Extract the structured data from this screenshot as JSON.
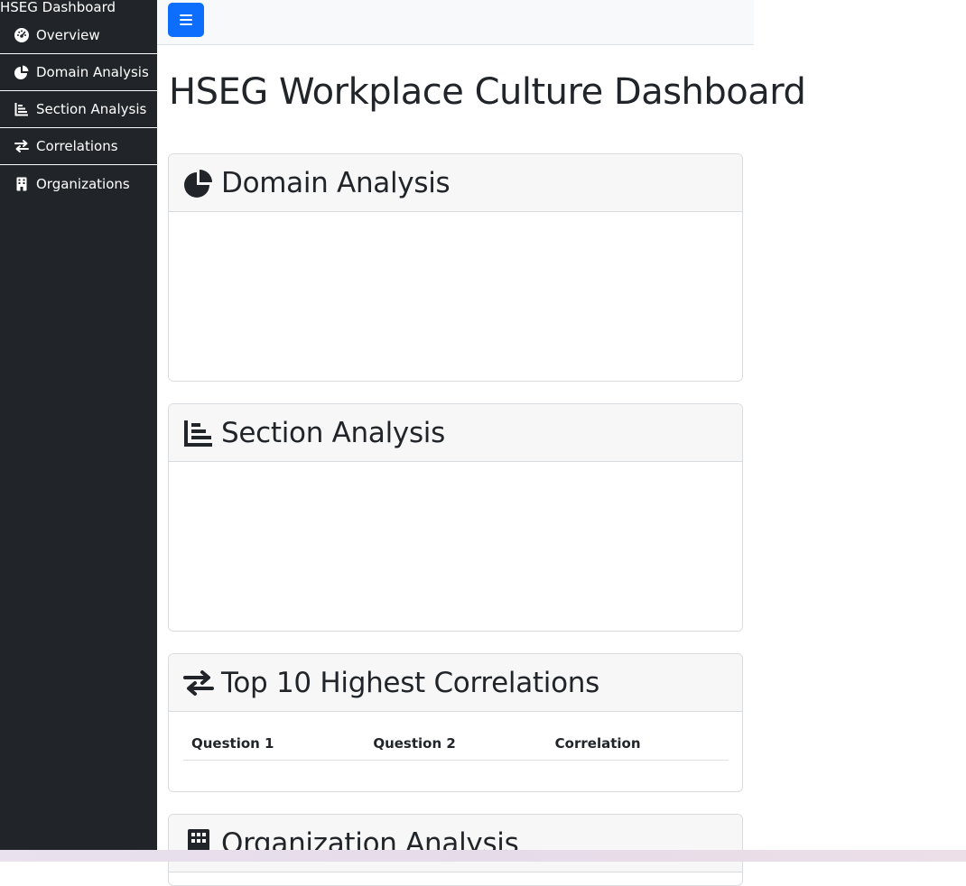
{
  "sidebar": {
    "title": "HSEG Dashboard",
    "items": [
      {
        "label": "Overview",
        "icon": "gauge-icon"
      },
      {
        "label": "Domain Analysis",
        "icon": "pie-chart-icon"
      },
      {
        "label": "Section Analysis",
        "icon": "bar-chart-icon"
      },
      {
        "label": "Correlations",
        "icon": "exchange-icon"
      },
      {
        "label": "Organizations",
        "icon": "building-icon"
      }
    ]
  },
  "topbar": {
    "toggle_icon": "menu-icon",
    "accent_color": "#0d6efd"
  },
  "main": {
    "title": "HSEG Workplace Culture Dashboard",
    "domain_card": {
      "title": "Domain Analysis",
      "icon": "pie-chart-icon"
    },
    "section_card": {
      "title": "Section Analysis",
      "icon": "bar-chart-icon"
    },
    "correlations_card": {
      "title": "Top 10 Highest Correlations",
      "icon": "exchange-icon",
      "columns": [
        "Question 1",
        "Question 2",
        "Correlation"
      ]
    },
    "organization_card": {
      "title": "Organization Analysis",
      "icon": "building-icon"
    }
  },
  "colors": {
    "sidebar_bg": "#212529",
    "header_bg": "#f7f7f7"
  }
}
